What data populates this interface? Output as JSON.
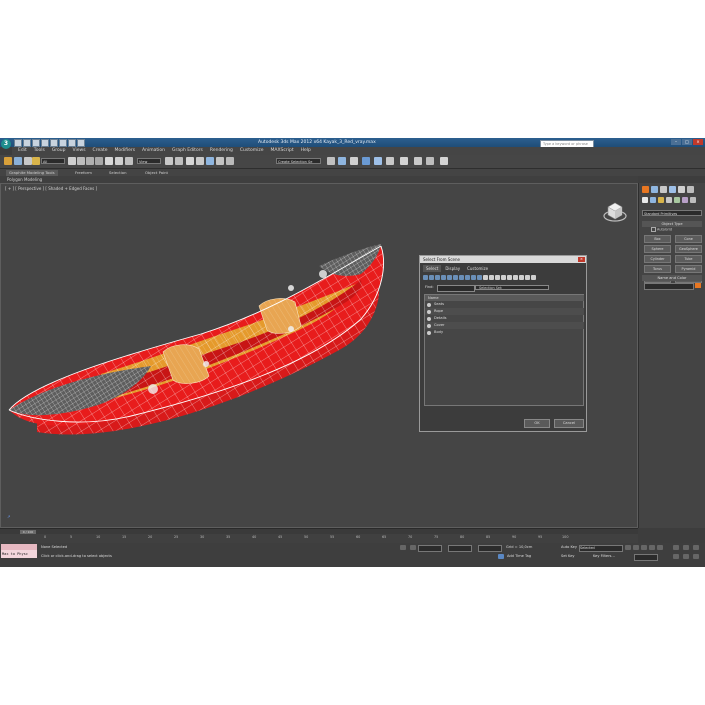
{
  "app": {
    "title": "Autodesk 3ds Max 2012 x64     Kayak_3_Red_vray.max",
    "search_placeholder": "Type a keyword or phrase",
    "logo": "3"
  },
  "menu": [
    "Edit",
    "Tools",
    "Group",
    "Views",
    "Create",
    "Modifiers",
    "Animation",
    "Graph Editors",
    "Rendering",
    "Customize",
    "MAXScript",
    "Help"
  ],
  "toolbar": {
    "selection_filter": "All",
    "ref_coord": "View",
    "named_selection": "Create Selection Se"
  },
  "ribbon": {
    "tabs": [
      "Graphite Modeling Tools",
      "Freeform",
      "Selection",
      "Object Paint"
    ],
    "active_tab": "Graphite Modeling Tools",
    "sub_label": "Polygon Modeling"
  },
  "viewport": {
    "label": "[ + ] [ Perspective ] [ Shaded + Edged Faces ]"
  },
  "command_panel": {
    "category": "Standard Primitives",
    "object_type_title": "Object Type",
    "autogrid": "AutoGrid",
    "primitives": [
      "Box",
      "Cone",
      "Sphere",
      "GeoSphere",
      "Cylinder",
      "Tube",
      "Torus",
      "Pyramid",
      "Teapot",
      "Plane"
    ],
    "name_color_title": "Name and Color",
    "accent_color": "#e87722"
  },
  "dialog": {
    "title": "Select From Scene",
    "menu": [
      "Select",
      "Display",
      "Customize"
    ],
    "find_label": "Find:",
    "selection_set_label": "Selection Set:",
    "column_header": "Name",
    "items": [
      "Seats",
      "Rope",
      "Details",
      "Cover",
      "Body"
    ],
    "ok": "OK",
    "cancel": "Cancel"
  },
  "timeline": {
    "slider": "0 / 100",
    "ticks": [
      "0",
      "5",
      "10",
      "15",
      "20",
      "25",
      "30",
      "35",
      "40",
      "45",
      "50",
      "55",
      "60",
      "65",
      "70",
      "75",
      "80",
      "85",
      "90",
      "95",
      "100"
    ]
  },
  "status": {
    "maxscript_text": "Max to Physc",
    "none_selected": "None Selected",
    "prompt": "Click or click-and-drag to select objects",
    "grid": "Grid = 10,0cm",
    "add_time_tag": "Add Time Tag",
    "auto_key": "Auto Key",
    "set_key": "Set Key",
    "selected": "Selected",
    "key_filters": "Key Filters..."
  }
}
